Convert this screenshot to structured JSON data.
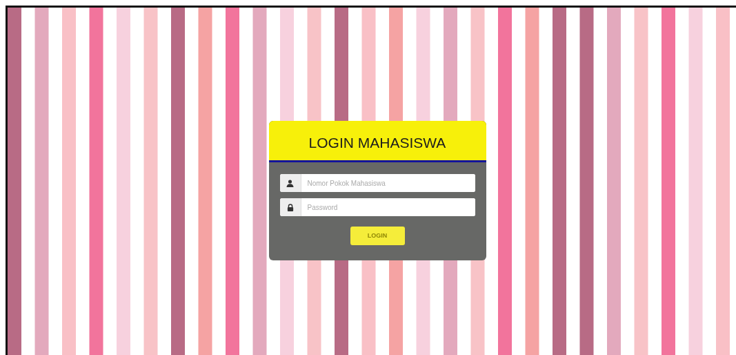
{
  "login_panel": {
    "title": "LOGIN MAHASISWA",
    "fields": [
      {
        "kind": "user",
        "placeholder": "Nomor Pokok Mahasiswa"
      },
      {
        "kind": "password",
        "placeholder": "Password"
      }
    ],
    "button": "LOGIN"
  }
}
